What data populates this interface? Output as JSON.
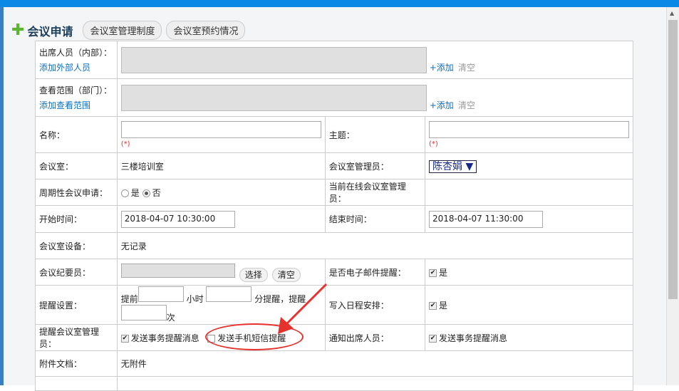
{
  "header": {
    "title": "会议申请",
    "tabs": [
      "会议室管理制度",
      "会议室预约情况"
    ]
  },
  "form": {
    "attendees": {
      "label": "出席人员（内部）：",
      "link": "添加外部人员",
      "add": "+添加",
      "clear": "清空"
    },
    "scope": {
      "label": "查看范围（部门）：",
      "link": "添加查看范围",
      "add": "+添加",
      "clear": "清空"
    },
    "name": {
      "label": "名称：",
      "required": "(*)"
    },
    "subject": {
      "label": "主题：",
      "required": "(*)"
    },
    "room": {
      "label": "会议室：",
      "value": "三楼培训室"
    },
    "room_admin": {
      "label": "会议室管理员：",
      "value": "陈杏娟"
    },
    "periodic": {
      "label": "周期性会议申请：",
      "yes": "是",
      "no": "否"
    },
    "online_admin": {
      "label": "当前在线会议室管理员："
    },
    "start": {
      "label": "开始时间：",
      "value": "2018-04-07 10:30:00"
    },
    "end": {
      "label": "结束时间：",
      "value": "2018-04-07 11:30:00"
    },
    "equipment": {
      "label": "会议室设备：",
      "value": "无记录"
    },
    "recorder": {
      "label": "会议纪要员：",
      "select": "选择",
      "clear": "清空"
    },
    "email_remind": {
      "label": "是否电子邮件提醒：",
      "value": "是"
    },
    "remind": {
      "label": "提醒设置：",
      "before": "提前",
      "hours": "小时",
      "minutes": "分提醒，提醒",
      "times": "次"
    },
    "calendar": {
      "label": "写入日程安排：",
      "value": "是"
    },
    "notify_admin": {
      "label": "提醒会议室管理员：",
      "msg": "发送事务提醒消息",
      "sms": "发送手机短信提醒"
    },
    "notify_attendees": {
      "label": "通知出席人员：",
      "msg": "发送事务提醒消息"
    },
    "attachments": {
      "label": "附件文档：",
      "value": "无附件"
    }
  }
}
